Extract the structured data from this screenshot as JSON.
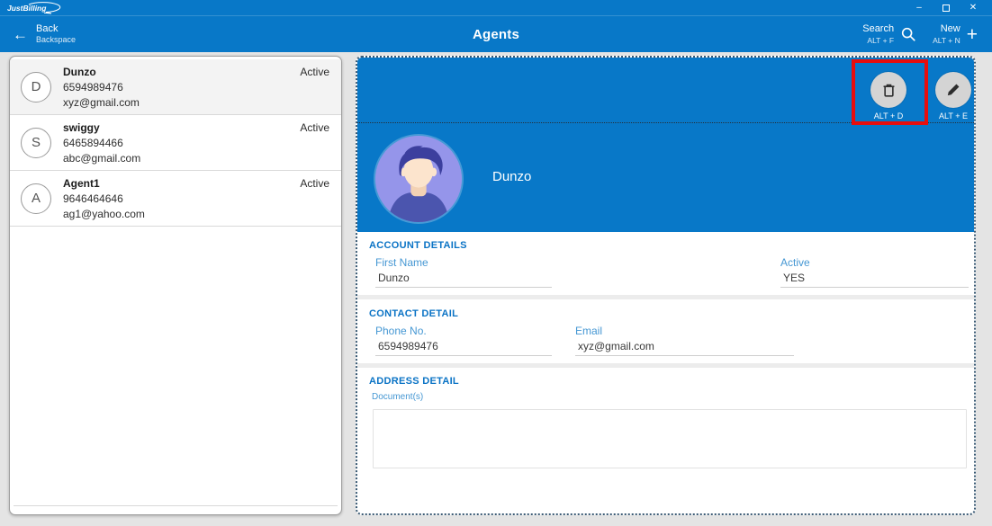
{
  "app": {
    "logo_text": "JustBilling",
    "window_controls": {
      "minimize": "–",
      "close": "✕"
    }
  },
  "header": {
    "title": "Agents",
    "back": {
      "icon": "←",
      "label": "Back",
      "shortcut": "Backspace"
    },
    "search": {
      "label": "Search",
      "shortcut": "ALT + F"
    },
    "new": {
      "label": "New",
      "shortcut": "ALT + N",
      "icon": "+"
    }
  },
  "agent_list": [
    {
      "initial": "D",
      "name": "Dunzo",
      "phone": "6594989476",
      "email": "xyz@gmail.com",
      "status": "Active"
    },
    {
      "initial": "S",
      "name": "swiggy",
      "phone": "6465894466",
      "email": "abc@gmail.com",
      "status": "Active"
    },
    {
      "initial": "A",
      "name": "Agent1",
      "phone": "9646464646",
      "email": "ag1@yahoo.com",
      "status": "Active"
    }
  ],
  "detail": {
    "name": "Dunzo",
    "delete_shortcut": "ALT + D",
    "edit_shortcut": "ALT + E",
    "account": {
      "title": "ACCOUNT DETAILS",
      "first_name_label": "First Name",
      "first_name_value": "Dunzo",
      "active_label": "Active",
      "active_value": "YES"
    },
    "contact": {
      "title": "CONTACT DETAIL",
      "phone_label": "Phone No.",
      "phone_value": "6594989476",
      "email_label": "Email",
      "email_value": "xyz@gmail.com"
    },
    "address": {
      "title": "ADDRESS DETAIL",
      "documents_label": "Document(s)"
    }
  },
  "colors": {
    "primary_blue": "#0878c8",
    "label_blue": "#4597d3",
    "section_title_blue": "#0a73c5",
    "highlight_red": "#e60e0e",
    "avatar_bg": "#9595ea",
    "button_circle_gray": "#d4d4d4"
  }
}
